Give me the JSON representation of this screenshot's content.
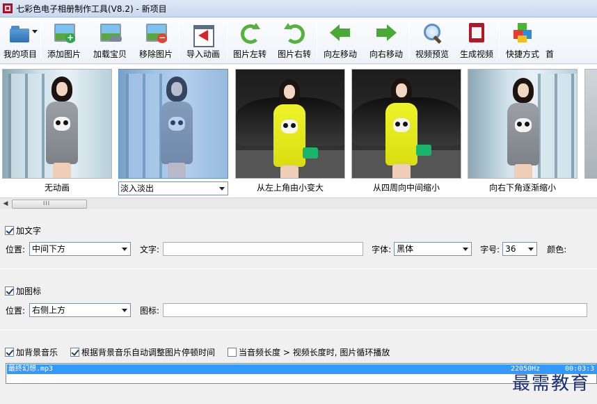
{
  "window": {
    "title": "七彩色电子相册制作工具(V8.2) - 新项目"
  },
  "toolbar": {
    "items": [
      {
        "label": "我的项目",
        "icon": "folder-icon"
      },
      {
        "label": "添加图片",
        "icon": "add-image-icon"
      },
      {
        "label": "加载宝贝",
        "icon": "load-item-icon"
      },
      {
        "label": "移除图片",
        "icon": "remove-image-icon"
      },
      {
        "label": "导入动画",
        "icon": "import-animation-icon"
      },
      {
        "label": "图片左转",
        "icon": "rotate-left-icon"
      },
      {
        "label": "图片右转",
        "icon": "rotate-right-icon"
      },
      {
        "label": "向左移动",
        "icon": "arrow-left-icon"
      },
      {
        "label": "向右移动",
        "icon": "arrow-right-icon"
      },
      {
        "label": "视频预览",
        "icon": "magnifier-icon"
      },
      {
        "label": "生成视频",
        "icon": "film-icon"
      },
      {
        "label": "快捷方式",
        "icon": "cubes-icon"
      },
      {
        "label": "首",
        "icon": ""
      }
    ]
  },
  "thumbnails": [
    {
      "caption": "无动画"
    },
    {
      "caption": "淡入淡出",
      "selected": true
    },
    {
      "caption": "从左上角由小变大"
    },
    {
      "caption": "从四周向中间缩小"
    },
    {
      "caption": "向右下角逐渐缩小"
    }
  ],
  "scrollbar": {
    "grip": "III"
  },
  "text_section": {
    "checkbox_label": "加文字",
    "checked": true,
    "position_label": "位置:",
    "position_value": "中间下方",
    "text_label": "文字:",
    "text_value": "",
    "font_label": "字体:",
    "font_value": "黑体",
    "size_label": "字号:",
    "size_value": "36",
    "color_label": "颜色:"
  },
  "icon_section": {
    "checkbox_label": "加图标",
    "checked": true,
    "position_label": "位置:",
    "position_value": "右侧上方",
    "icon_label": "图标:",
    "icon_value": ""
  },
  "music_section": {
    "bg_music_label": "加背景音乐",
    "bg_music_checked": true,
    "auto_adjust_label": "根据背景音乐自动调整图片停顿时间",
    "auto_adjust_checked": true,
    "loop_label": "当音频长度 > 视频长度时, 图片循环播放",
    "loop_checked": false,
    "tracks": [
      {
        "name": "最终幻想.mp3",
        "rate": "22050Hz",
        "duration": "00:03:3"
      }
    ]
  },
  "watermark": "最需教育"
}
